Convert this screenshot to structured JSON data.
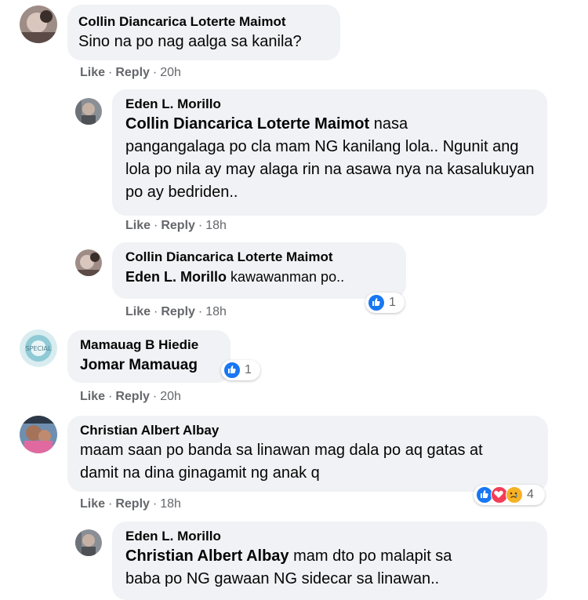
{
  "actions": {
    "like": "Like",
    "reply": "Reply",
    "dot": "·"
  },
  "comments": [
    {
      "author": "Collin Diancarica Loterte Maimot",
      "text": "Sino na po nag aalga sa kanila?",
      "time": "20h"
    },
    {
      "author": "Eden L. Morillo",
      "mention": "Collin Diancarica Loterte Maimot",
      "text_line1": " nasa",
      "text_rest": "pangangalaga po cla mam NG kanilang lola.. Ngunit ang lola po nila ay may alaga rin na asawa nya na kasalukuyan po ay bedriden..",
      "time": "18h"
    },
    {
      "author": "Collin Diancarica Loterte Maimot",
      "mention": "Eden L. Morillo",
      "text": " kawawanman po..",
      "time": "18h",
      "reaction_count": "1"
    },
    {
      "author": "Mamauag B Hiedie",
      "mention": "Jomar Mamauag",
      "time": "20h",
      "reaction_count": "1"
    },
    {
      "author": "Christian Albert Albay",
      "text_line1": "maam saan po banda sa linawan mag dala po aq gatas at",
      "text_line2": "damit na dina ginagamit ng anak q",
      "time": "18h",
      "reaction_count": "4"
    },
    {
      "author": "Eden L. Morillo",
      "mention": "Christian Albert Albay",
      "text_line1": " mam dto po malapit sa",
      "text_line2": "baba po NG gawaan NG sidecar sa linawan.."
    }
  ],
  "colors": {
    "like": "#1877f2",
    "love": "#f33e58",
    "sad": "#f7b125",
    "bubble": "#f0f2f5",
    "meta": "#65676b"
  }
}
